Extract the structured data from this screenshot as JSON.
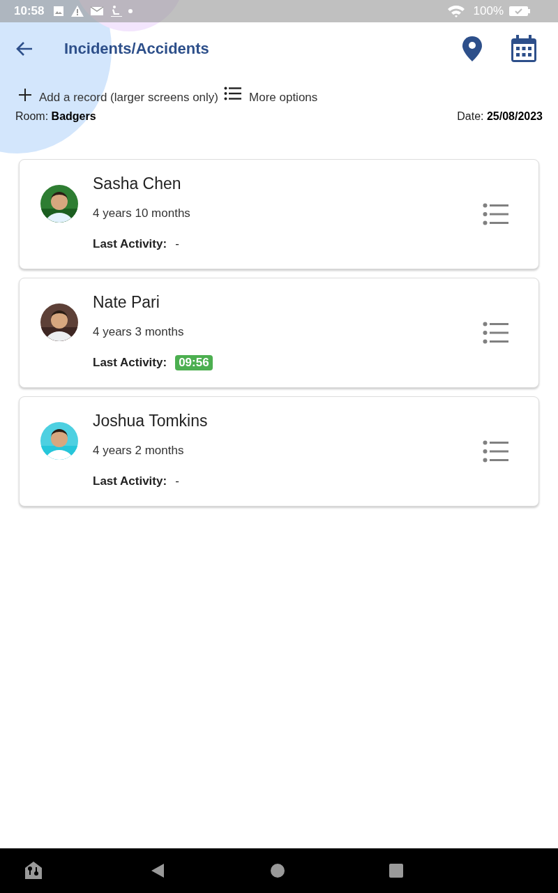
{
  "status_bar": {
    "time": "10:58",
    "battery": "100%"
  },
  "header": {
    "title": "Incidents/Accidents"
  },
  "actions": [
    {
      "kind": "add",
      "label": "Add a record (larger screens only)"
    },
    {
      "kind": "options",
      "label": "More options"
    }
  ],
  "room": {
    "label": "Room:",
    "value": "Badgers"
  },
  "date": {
    "label": "Date:",
    "value": "25/08/2023"
  },
  "children": [
    {
      "name": "Sasha Chen",
      "age": "4 years 10 months",
      "activity_label": "Last Activity:",
      "last_activity": {
        "kind": "plain",
        "text": "-"
      }
    },
    {
      "name": "Nate Pari",
      "age": "4 years 3 months",
      "activity_label": "Last Activity:",
      "last_activity": {
        "kind": "badge",
        "text": "09:56"
      }
    },
    {
      "name": "Joshua Tomkins",
      "age": "4 years 2 months",
      "activity_label": "Last Activity:",
      "last_activity": {
        "kind": "plain",
        "text": "-"
      }
    }
  ]
}
